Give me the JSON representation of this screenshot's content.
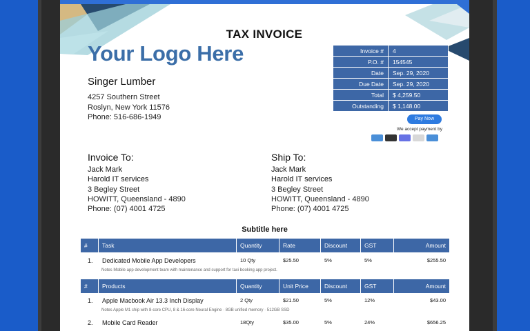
{
  "invoice": {
    "title": "TAX INVOICE",
    "logo_text": "Your Logo Here",
    "seller": {
      "name": "Singer Lumber",
      "address_lines": [
        "4257 Southern Street",
        "Roslyn, New York 11576",
        "Phone: 516-686-1949"
      ]
    },
    "meta": [
      {
        "label": "Invoice #",
        "value": "4"
      },
      {
        "label": "P.O. #",
        "value": "154545"
      },
      {
        "label": "Date",
        "value": "Sep. 29, 2020"
      },
      {
        "label": "Due Date",
        "value": "Sep. 29, 2020"
      },
      {
        "label": "Total",
        "value": "$ 4,259.50"
      },
      {
        "label": "Outstanding",
        "value": "$ 1,148.00"
      }
    ],
    "pay_now_label": "Pay Now",
    "accept_text": "We accept payment by",
    "payment_methods": [
      {
        "name": "stripe",
        "color": "#4a8fd8"
      },
      {
        "name": "square",
        "color": "#333333"
      },
      {
        "name": "stripe",
        "color": "#6772e5"
      },
      {
        "name": "upi",
        "color": "#d8d8d8"
      },
      {
        "name": "visa",
        "color": "#4a8fd8"
      }
    ],
    "invoice_to": {
      "heading": "Invoice To:",
      "lines": [
        "Jack Mark",
        "Harold IT services",
        "3 Begley Street",
        "HOWITT, Queensland - 4890",
        "Phone: (07) 4001 4725"
      ]
    },
    "ship_to": {
      "heading": "Ship To:",
      "lines": [
        "Jack Mark",
        "Harold IT services",
        "3 Begley Street",
        "HOWITT, Queensland - 4890",
        "Phone: (07) 4001 4725"
      ]
    },
    "subtitle": "Subtitle here",
    "tasks_table": {
      "headers": [
        "#",
        "Task",
        "Quantity",
        "Rate",
        "Discount",
        "GST",
        "Amount"
      ],
      "rows": [
        {
          "num": "1.",
          "name": "Dedicated Mobile App Developers",
          "qty": "10 Qty",
          "rate": "$25.50",
          "discount": "5%",
          "gst": "5%",
          "amount": "$255.50",
          "note": "Notes Mobile app development team with maintenance and support for taxi booking app project."
        }
      ]
    },
    "products_table": {
      "headers": [
        "#",
        "Products",
        "Quantity",
        "Unit Price",
        "Discount",
        "GST",
        "Amount"
      ],
      "rows": [
        {
          "num": "1.",
          "name": "Apple Macbook Air 13.3 Inch Display",
          "qty": "2 Qty",
          "rate": "$21.50",
          "discount": "5%",
          "gst": "12%",
          "amount": "$43.00",
          "note": "Notes Apple M1 chip with 8-core CPU, 8 & 16-core Neural Engine · 8GB unified memory · 512GB SSD"
        },
        {
          "num": "2.",
          "name": "Mobile Card Reader",
          "qty": "18Qty",
          "rate": "$35.00",
          "discount": "5%",
          "gst": "24%",
          "amount": "$656.25"
        }
      ]
    }
  },
  "colors": {
    "background_blue": "#1a5cc9",
    "header_blue": "#3d67a6",
    "logo_blue": "#3b6ea8",
    "pay_button": "#2e7be0"
  }
}
